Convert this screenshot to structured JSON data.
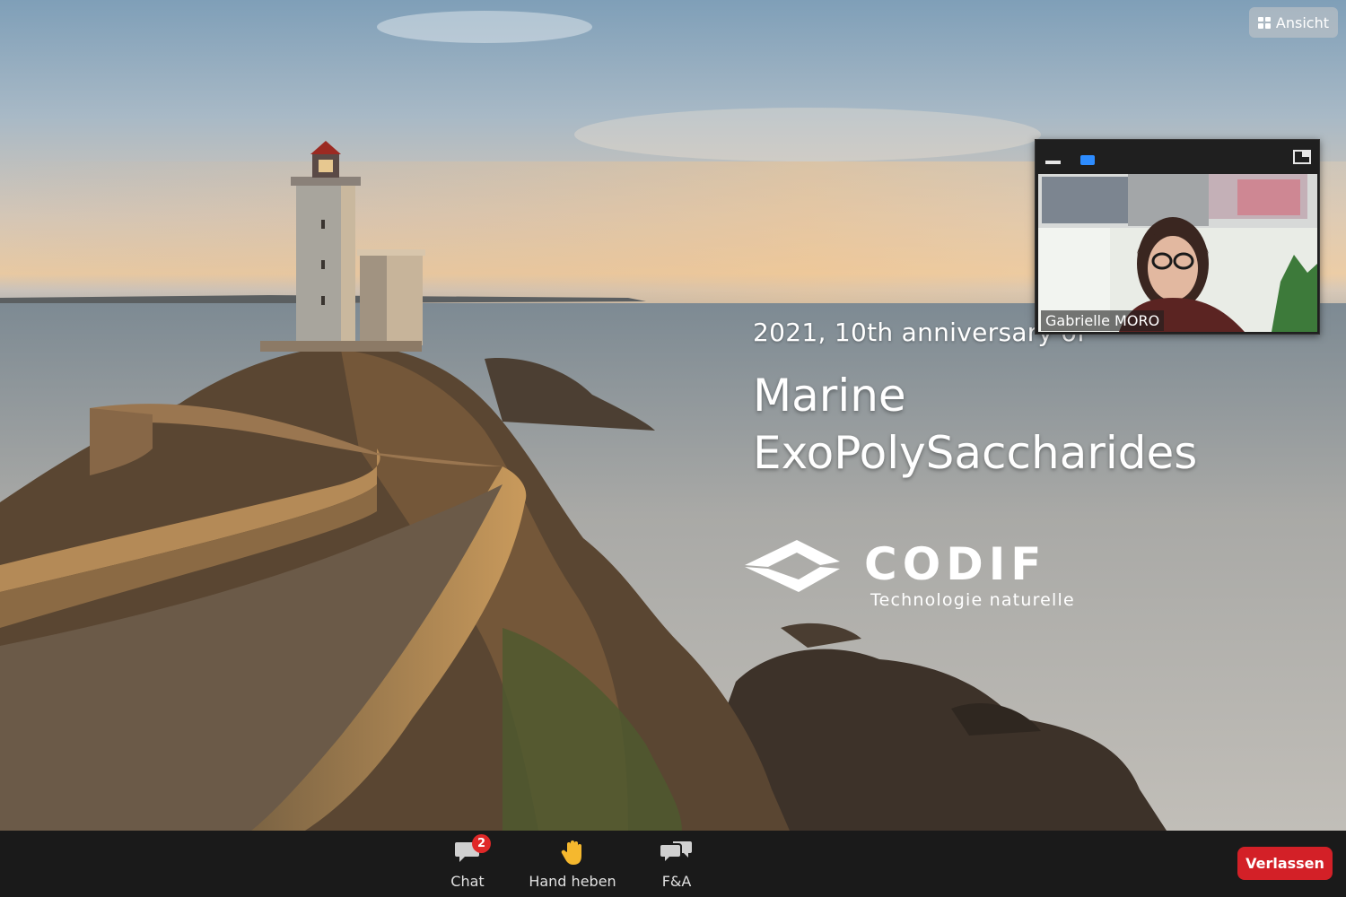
{
  "top_bar": {
    "view_label": "Ansicht"
  },
  "slide": {
    "subtitle": "2021, 10th anniversary of",
    "title_line1": "Marine",
    "title_line2": "ExoPolySaccharides",
    "logo_word": "CODIF",
    "logo_tagline": "Technologie naturelle"
  },
  "video": {
    "participant_name": "Gabrielle MORO"
  },
  "toolbar": {
    "chat_label": "Chat",
    "chat_badge": "2",
    "hand_label": "Hand heben",
    "qa_label": "F&A",
    "leave_label": "Verlassen"
  },
  "colors": {
    "leave": "#d32027",
    "badge": "#e02828",
    "camera_indicator": "#2d8cff",
    "toolbar_bg": "#1a1a1a"
  }
}
